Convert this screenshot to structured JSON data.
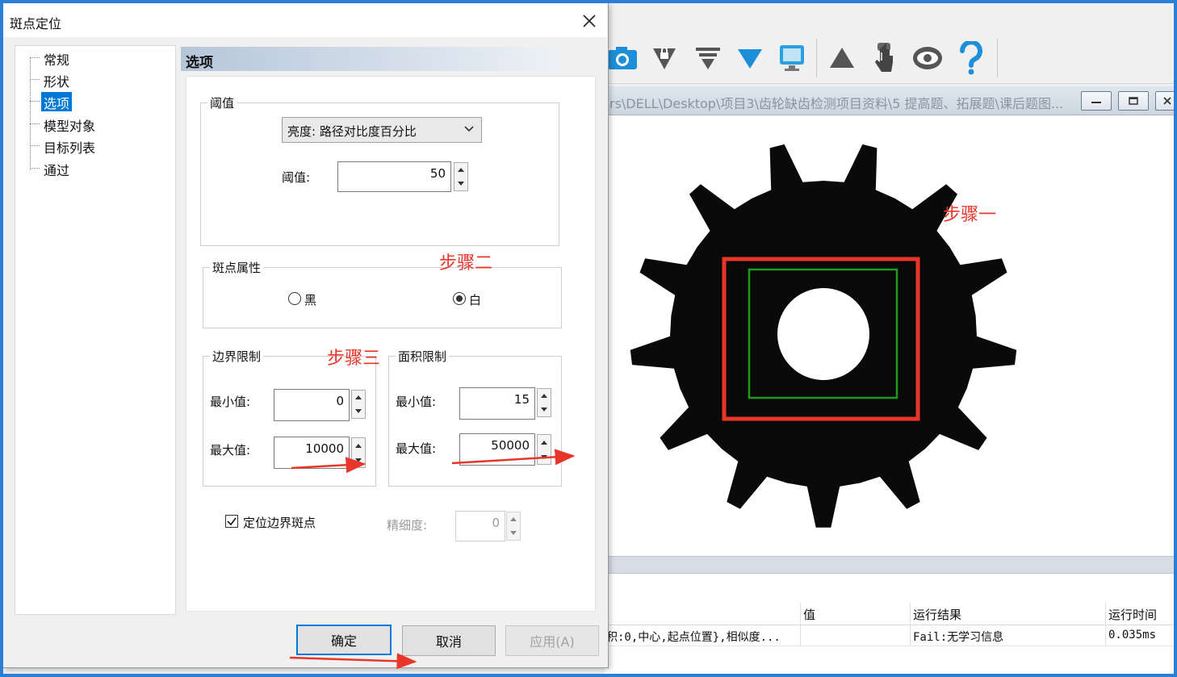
{
  "dialog": {
    "title": "斑点定位",
    "tree": [
      "常规",
      "形状",
      "选项",
      "模型对象",
      "目标列表",
      "通过"
    ],
    "selected_tree_index": 2,
    "section_title": "选项",
    "threshold": {
      "group_label": "阈值",
      "mode_value": "亮度: 路径对比度百分比",
      "value_label": "阈值:",
      "value": "50"
    },
    "blob_attr": {
      "group_label": "斑点属性",
      "black_label": "黑",
      "white_label": "白",
      "selected": "白"
    },
    "border_limit": {
      "group_label": "边界限制",
      "min_label": "最小值:",
      "min_value": "0",
      "max_label": "最大值:",
      "max_value": "10000"
    },
    "area_limit": {
      "group_label": "面积限制",
      "min_label": "最小值:",
      "min_value": "15",
      "max_label": "最大值:",
      "max_value": "50000"
    },
    "locate_border": {
      "label": "定位边界斑点",
      "checked": true
    },
    "precision": {
      "label": "精细度:",
      "value": "0"
    },
    "buttons": {
      "ok": "确定",
      "cancel": "取消",
      "apply": "应用(A)"
    }
  },
  "annotations": {
    "step1": "步骤一",
    "step2": "步骤二",
    "step3": "步骤三",
    "accent_color": "#e8372a"
  },
  "background_app": {
    "toolbar_icons": [
      "camera-icon",
      "shield-lock-icon",
      "funnel-icon",
      "triangle-down-icon",
      "monitor-icon",
      "triangle-up-icon",
      "hand-touch-icon",
      "eye-icon",
      "help-icon"
    ],
    "doc_path": "rs\\DELL\\Desktop\\项目3\\齿轮缺齿检测项目资料\\5 提高题、拓展题\\课后题图...",
    "results": {
      "headers": [
        "值",
        "运行结果",
        "运行时间"
      ],
      "row": {
        "value": "积:0,中心,起点位置},相似度...",
        "result": "Fail:无学习信息",
        "time": "0.035ms"
      }
    }
  }
}
